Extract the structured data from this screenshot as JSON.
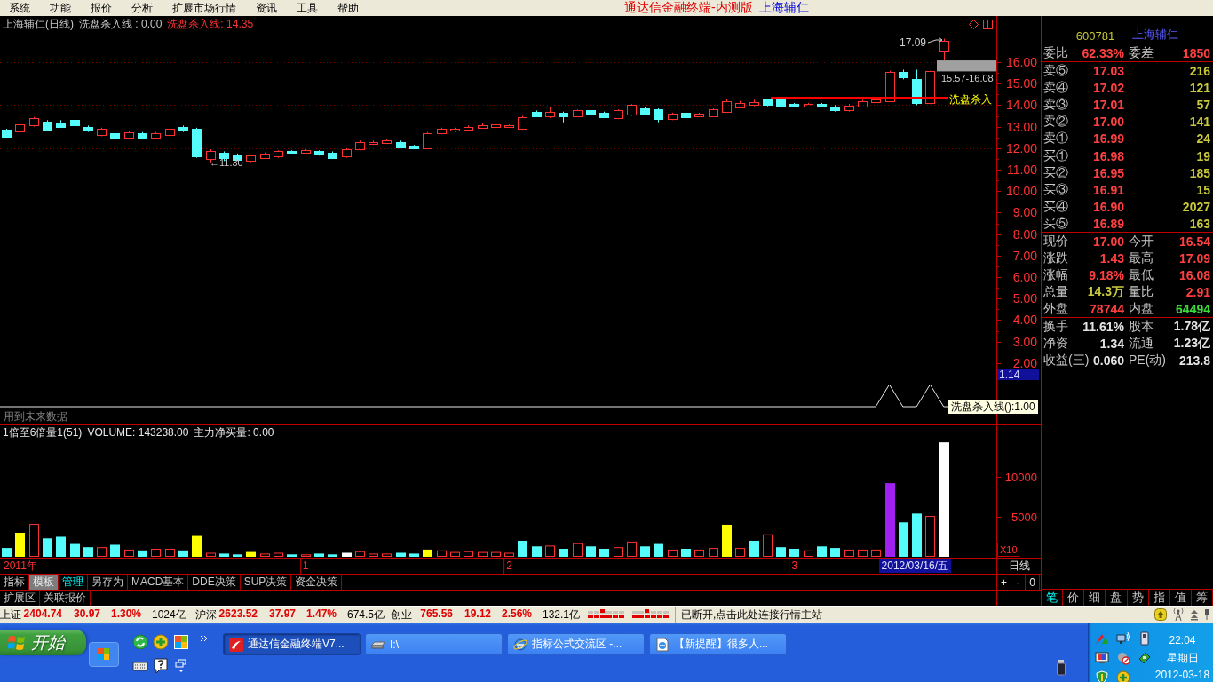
{
  "menu_bar": {
    "items": [
      "系统",
      "功能",
      "报价",
      "分析",
      "扩展市场行情",
      "资讯",
      "工具",
      "帮助"
    ],
    "app_title": "通达信金融终端-内测版",
    "stock_name": "上海辅仁"
  },
  "main_chart": {
    "title": "上海辅仁(日线)",
    "indicator": "洗盘杀入线 : 0.00",
    "indicator_value": "洗盘杀入线: 14.35",
    "high_label": "17.09",
    "gap_label": "15.57-16.08",
    "line_label": "洗盘杀入",
    "low_label": "←11.30"
  },
  "price_axis": {
    "labels": [
      "16.00",
      "15.00",
      "14.00",
      "13.00",
      "12.00",
      "11.00",
      "10.00",
      "9.00",
      "8.00",
      "7.00",
      "6.00",
      "5.00",
      "4.00",
      "3.00",
      "2.00"
    ],
    "cursor_value": "1.14"
  },
  "signal_panel": {
    "warning": "用到未来数据",
    "tooltip": "洗盘杀入线():1.00"
  },
  "volume_panel": {
    "header": [
      "1倍至6倍量1(51)",
      "VOLUME: 143238.00",
      "主力净买量: 0.00"
    ],
    "scale_badge": "X10",
    "bars": [
      {
        "kind": "solid",
        "color": "#54fcfc"
      },
      {
        "kind": "solid",
        "color": "#ffff00"
      },
      {
        "kind": "hollow",
        "color": "#ff3232"
      },
      {
        "kind": "solid",
        "color": "#54fcfc"
      },
      {
        "kind": "solid",
        "color": "#54fcfc"
      },
      {
        "kind": "solid",
        "color": "#54fcfc"
      },
      {
        "kind": "solid",
        "color": "#54fcfc"
      },
      {
        "kind": "hollow",
        "color": "#ff3232"
      },
      {
        "kind": "solid",
        "color": "#54fcfc"
      },
      {
        "kind": "hollow",
        "color": "#ff3232"
      },
      {
        "kind": "solid",
        "color": "#54fcfc"
      },
      {
        "kind": "hollow",
        "color": "#ff3232"
      },
      {
        "kind": "hollow",
        "color": "#ff3232"
      },
      {
        "kind": "solid",
        "color": "#54fcfc"
      },
      {
        "kind": "solid",
        "color": "#ffff00"
      },
      {
        "kind": "hollow",
        "color": "#ff3232"
      },
      {
        "kind": "solid",
        "color": "#54fcfc"
      },
      {
        "kind": "solid",
        "color": "#54fcfc"
      },
      {
        "kind": "solid",
        "color": "#ffff00"
      },
      {
        "kind": "hollow",
        "color": "#ff3232"
      },
      {
        "kind": "hollow",
        "color": "#ff3232"
      },
      {
        "kind": "solid",
        "color": "#54fcfc"
      },
      {
        "kind": "hollow",
        "color": "#ff3232"
      },
      {
        "kind": "solid",
        "color": "#54fcfc"
      },
      {
        "kind": "solid",
        "color": "#54fcfc"
      },
      {
        "kind": "solid",
        "color": "#ffffff"
      },
      {
        "kind": "hollow",
        "color": "#ff3232"
      },
      {
        "kind": "hollow",
        "color": "#ff3232"
      },
      {
        "kind": "hollow",
        "color": "#ff3232"
      },
      {
        "kind": "solid",
        "color": "#54fcfc"
      },
      {
        "kind": "solid",
        "color": "#54fcfc"
      },
      {
        "kind": "solid",
        "color": "#ffff00"
      },
      {
        "kind": "hollow",
        "color": "#ff3232"
      },
      {
        "kind": "hollow",
        "color": "#ff3232"
      },
      {
        "kind": "hollow",
        "color": "#ff3232"
      },
      {
        "kind": "hollow",
        "color": "#ff3232"
      },
      {
        "kind": "hollow",
        "color": "#ff3232"
      },
      {
        "kind": "hollow",
        "color": "#ff3232"
      },
      {
        "kind": "solid",
        "color": "#54fcfc"
      },
      {
        "kind": "solid",
        "color": "#54fcfc"
      },
      {
        "kind": "hollow",
        "color": "#ff3232"
      },
      {
        "kind": "solid",
        "color": "#54fcfc"
      },
      {
        "kind": "hollow",
        "color": "#ff3232"
      },
      {
        "kind": "solid",
        "color": "#54fcfc"
      },
      {
        "kind": "solid",
        "color": "#54fcfc"
      },
      {
        "kind": "hollow",
        "color": "#ff3232"
      },
      {
        "kind": "hollow",
        "color": "#ff3232"
      },
      {
        "kind": "solid",
        "color": "#54fcfc"
      },
      {
        "kind": "solid",
        "color": "#54fcfc"
      },
      {
        "kind": "hollow",
        "color": "#ff3232"
      },
      {
        "kind": "solid",
        "color": "#54fcfc"
      },
      {
        "kind": "hollow",
        "color": "#ff3232"
      },
      {
        "kind": "hollow",
        "color": "#ff3232"
      },
      {
        "kind": "solid",
        "color": "#ffff00"
      },
      {
        "kind": "hollow",
        "color": "#ff3232"
      },
      {
        "kind": "solid",
        "color": "#54fcfc"
      },
      {
        "kind": "hollow",
        "color": "#ff3232"
      },
      {
        "kind": "solid",
        "color": "#54fcfc"
      },
      {
        "kind": "solid",
        "color": "#54fcfc"
      },
      {
        "kind": "hollow",
        "color": "#ff3232"
      },
      {
        "kind": "solid",
        "color": "#54fcfc"
      },
      {
        "kind": "solid",
        "color": "#54fcfc"
      },
      {
        "kind": "hollow",
        "color": "#ff3232"
      },
      {
        "kind": "hollow",
        "color": "#ff3232"
      },
      {
        "kind": "hollow",
        "color": "#ff3232"
      },
      {
        "kind": "solid",
        "color": "#a020f0"
      },
      {
        "kind": "solid",
        "color": "#54fcfc"
      },
      {
        "kind": "solid",
        "color": "#54fcfc"
      },
      {
        "kind": "hollow",
        "color": "#ff3232"
      },
      {
        "kind": "solid",
        "color": "#ffffff"
      }
    ],
    "chart_data": {
      "type": "bar",
      "categories": [
        null,
        null,
        null,
        null,
        null,
        null,
        null,
        null,
        null,
        null,
        null,
        null,
        null,
        null,
        null,
        null,
        null,
        null,
        null,
        null,
        null,
        null,
        "1",
        null,
        null,
        null,
        null,
        null,
        null,
        null,
        null,
        null,
        null,
        null,
        null,
        null,
        null,
        "2",
        null,
        null,
        null,
        null,
        null,
        null,
        null,
        null,
        null,
        null,
        null,
        null,
        null,
        null,
        null,
        null,
        null,
        null,
        null,
        null,
        "3",
        null,
        null,
        null,
        null,
        null,
        null,
        null,
        null,
        null,
        null,
        null
      ],
      "ylim": [
        0,
        14650
      ],
      "yticks": [
        {
          "value": 5000,
          "label": "5000"
        },
        {
          "value": 10000,
          "label": "10000"
        }
      ],
      "values": [
        1100,
        3000,
        4100,
        2300,
        2500,
        1600,
        1200,
        1200,
        1500,
        900,
        800,
        1000,
        1000,
        800,
        2600,
        500,
        400,
        300,
        600,
        400,
        500,
        300,
        300,
        400,
        300,
        500,
        700,
        400,
        400,
        500,
        400,
        900,
        800,
        600,
        700,
        600,
        600,
        500,
        2000,
        1300,
        1400,
        1000,
        1700,
        1300,
        1000,
        1200,
        1900,
        1300,
        1600,
        900,
        1000,
        900,
        1100,
        4000,
        1100,
        2000,
        2800,
        1200,
        1000,
        800,
        1300,
        1100,
        900,
        900,
        900,
        9200,
        4300,
        5400,
        5100,
        14300
      ]
    }
  },
  "date_axis": {
    "year_label": "2011年",
    "cursor_date": "2012/03/16/五",
    "period_label": "日线"
  },
  "formula_tabs": [
    {
      "label": "指标",
      "selected": false,
      "highlighted": false
    },
    {
      "label": "模板",
      "selected": false,
      "highlighted": true
    },
    {
      "label": "管理",
      "selected": true,
      "highlighted": false
    },
    {
      "label": "另存为",
      "selected": false,
      "highlighted": false
    },
    {
      "label": "MACD基本",
      "selected": false,
      "highlighted": false
    },
    {
      "label": "DDE决策",
      "selected": false,
      "highlighted": false
    },
    {
      "label": "SUP决策",
      "selected": false,
      "highlighted": false
    },
    {
      "label": "资金决策",
      "selected": false,
      "highlighted": false
    }
  ],
  "zoom_buttons": [
    "+",
    "-",
    "0"
  ],
  "extension_tabs": [
    "扩展区",
    "关联报价"
  ],
  "quote_panel": {
    "code": "600781",
    "name": "上海辅仁",
    "ratio": [
      {
        "label": "委比",
        "value": "62.33%",
        "color": "#ff4040"
      },
      {
        "label": "委差",
        "value": "1850",
        "color": "#ff4040"
      }
    ],
    "asks": [
      {
        "label": "卖⑤",
        "price": "17.03",
        "volume": "216"
      },
      {
        "label": "卖④",
        "price": "17.02",
        "volume": "121"
      },
      {
        "label": "卖③",
        "price": "17.01",
        "volume": "57"
      },
      {
        "label": "卖②",
        "price": "17.00",
        "volume": "141"
      },
      {
        "label": "卖①",
        "price": "16.99",
        "volume": "24"
      }
    ],
    "bids": [
      {
        "label": "买①",
        "price": "16.98",
        "volume": "19"
      },
      {
        "label": "买②",
        "price": "16.95",
        "volume": "185"
      },
      {
        "label": "买③",
        "price": "16.91",
        "volume": "15"
      },
      {
        "label": "买④",
        "price": "16.90",
        "volume": "2027"
      },
      {
        "label": "买⑤",
        "price": "16.89",
        "volume": "163"
      }
    ],
    "stats": [
      {
        "label": "现价",
        "value": "17.00",
        "color": "#ff4040"
      },
      {
        "label": "今开",
        "value": "16.54",
        "color": "#ff4040"
      },
      {
        "label": "涨跌",
        "value": "1.43",
        "color": "#ff4040"
      },
      {
        "label": "最高",
        "value": "17.09",
        "color": "#ff4040"
      },
      {
        "label": "涨幅",
        "value": "9.18%",
        "color": "#ff4040"
      },
      {
        "label": "最低",
        "value": "16.08",
        "color": "#ff4040"
      },
      {
        "label": "总量",
        "value": "14.3万",
        "color": "#c8c83c"
      },
      {
        "label": "量比",
        "value": "2.91",
        "color": "#ff4040"
      },
      {
        "label": "外盘",
        "value": "78744",
        "color": "#ff4040"
      },
      {
        "label": "内盘",
        "value": "64494",
        "color": "#3cdc3c"
      }
    ],
    "finance": [
      {
        "label": "换手",
        "value": "11.61%"
      },
      {
        "label": "股本",
        "value": "1.78亿"
      },
      {
        "label": "净资",
        "value": "1.34"
      },
      {
        "label": "流通",
        "value": "1.23亿"
      },
      {
        "label": "收益(三)",
        "value": "0.060"
      },
      {
        "label": "PE(动)",
        "value": "213.8"
      }
    ],
    "tabs": [
      {
        "label": "笔",
        "selected": true
      },
      {
        "label": "价",
        "selected": false
      },
      {
        "label": "细",
        "selected": false
      },
      {
        "label": "盘",
        "selected": false
      },
      {
        "label": "势",
        "selected": false
      },
      {
        "label": "指",
        "selected": false
      },
      {
        "label": "值",
        "selected": false
      },
      {
        "label": "筹",
        "selected": false
      }
    ]
  },
  "status_bar": {
    "indices": [
      {
        "name": "上证",
        "value": "2404.74",
        "change": "30.97",
        "percent": "1.30%",
        "turnover": "1024亿"
      },
      {
        "name": "沪深",
        "value": "2623.52",
        "change": "37.97",
        "percent": "1.47%",
        "turnover": "674.5亿"
      },
      {
        "name": "创业",
        "value": "765.56",
        "change": "19.12",
        "percent": "2.56%",
        "turnover": "132.1亿"
      }
    ],
    "message": "已断开,点击此处连接行情主站"
  },
  "taskbar": {
    "start": "开始",
    "tasks": [
      {
        "label": "通达信金融终端V7...",
        "selected": true
      },
      {
        "label": "I:\\",
        "selected": false
      },
      {
        "label": "指标公式交流区 -...",
        "selected": false
      },
      {
        "label": "【新提醒】很多人...",
        "selected": false
      }
    ],
    "clock": {
      "time": "22:04",
      "weekday": "星期日",
      "date": "2012-03-18"
    }
  }
}
